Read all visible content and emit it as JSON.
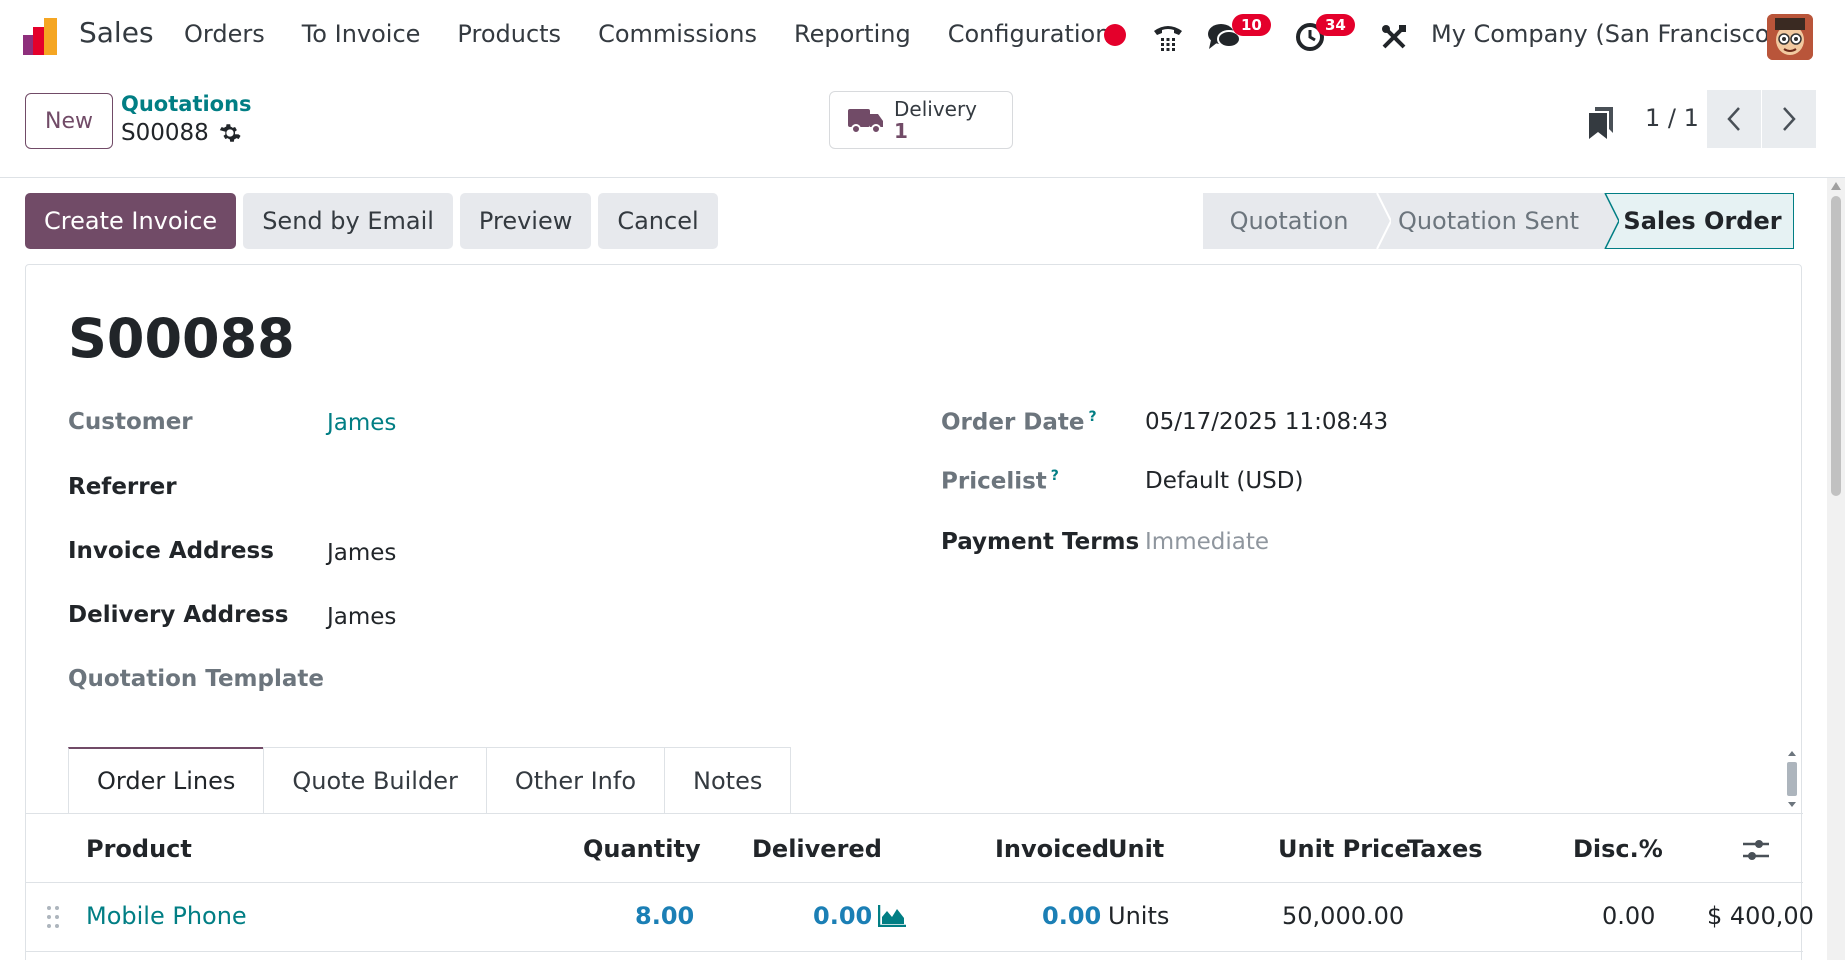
{
  "navbar": {
    "app_name": "Sales",
    "menu": [
      "Orders",
      "To Invoice",
      "Products",
      "Commissions",
      "Reporting",
      "Configuration"
    ],
    "messages_count": "10",
    "activities_count": "34",
    "company": "My Company (San Francisco)"
  },
  "control_panel": {
    "new_label": "New",
    "breadcrumb_parent": "Quotations",
    "breadcrumb_current": "S00088",
    "delivery_label": "Delivery",
    "delivery_count": "1",
    "pager": "1 / 1"
  },
  "actions": {
    "create_invoice": "Create Invoice",
    "send_email": "Send by Email",
    "preview": "Preview",
    "cancel": "Cancel"
  },
  "stages": {
    "quotation": "Quotation",
    "quotation_sent": "Quotation Sent",
    "sales_order": "Sales Order",
    "current": "Sales Order"
  },
  "form": {
    "title": "S00088",
    "customer_label": "Customer",
    "customer_value": "James",
    "referrer_label": "Referrer",
    "invoice_address_label": "Invoice Address",
    "invoice_address_value": "James",
    "delivery_address_label": "Delivery Address",
    "delivery_address_value": "James",
    "quotation_template_label": "Quotation Template",
    "order_date_label": "Order Date",
    "order_date_value": "05/17/2025 11:08:43",
    "pricelist_label": "Pricelist",
    "pricelist_value": "Default (USD)",
    "payment_terms_label": "Payment Terms",
    "payment_terms_value": "Immediate",
    "help_mark": "?"
  },
  "tabs": [
    "Order Lines",
    "Quote Builder",
    "Other Info",
    "Notes"
  ],
  "order_lines": {
    "columns": {
      "product": "Product",
      "quantity": "Quantity",
      "delivered": "Delivered",
      "invoiced": "Invoiced",
      "unit": "Unit",
      "unit_price": "Unit Price",
      "taxes": "Taxes",
      "discount": "Disc.%"
    },
    "rows": [
      {
        "product": "Mobile Phone",
        "quantity": "8.00",
        "delivered": "0.00",
        "invoiced": "0.00",
        "unit": "Units",
        "unit_price": "50,000.00",
        "taxes": "",
        "discount": "0.00",
        "subtotal": "$ 400,00"
      }
    ]
  },
  "colors": {
    "brand": "#714b67",
    "link": "#017e84",
    "badge": "#e4002b"
  }
}
